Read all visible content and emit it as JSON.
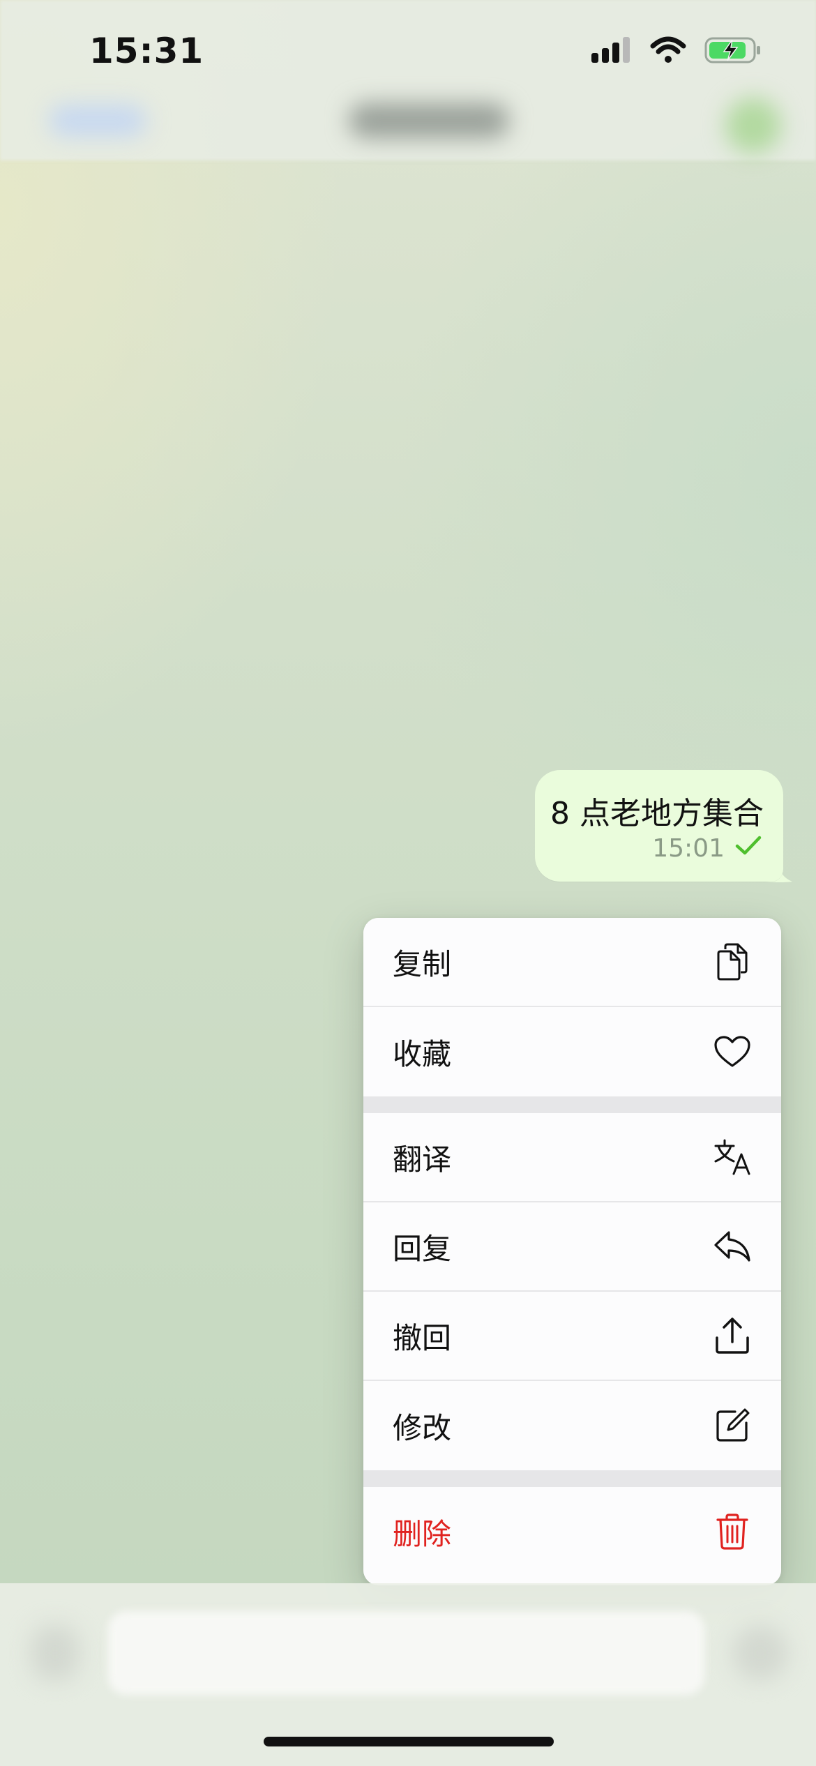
{
  "status_bar": {
    "time": "15:31",
    "icons": [
      "cellular-signal-icon",
      "wifi-icon",
      "battery-charging-icon"
    ],
    "battery_color": "#4cd964"
  },
  "message": {
    "text": "8 点老地方集合",
    "time": "15:01",
    "status_icon": "checkmark-icon",
    "bubble_color": "#eafcdc",
    "check_color": "#4fbf2e"
  },
  "context_menu": {
    "groups": [
      [
        {
          "label": "复制",
          "icon": "copy-icon"
        },
        {
          "label": "收藏",
          "icon": "heart-icon"
        }
      ],
      [
        {
          "label": "翻译",
          "icon": "translate-icon"
        },
        {
          "label": "回复",
          "icon": "reply-icon"
        },
        {
          "label": "撤回",
          "icon": "upload-icon"
        },
        {
          "label": "修改",
          "icon": "edit-icon"
        }
      ],
      [
        {
          "label": "删除",
          "icon": "trash-icon",
          "danger_color": "#e0221f"
        }
      ]
    ]
  }
}
